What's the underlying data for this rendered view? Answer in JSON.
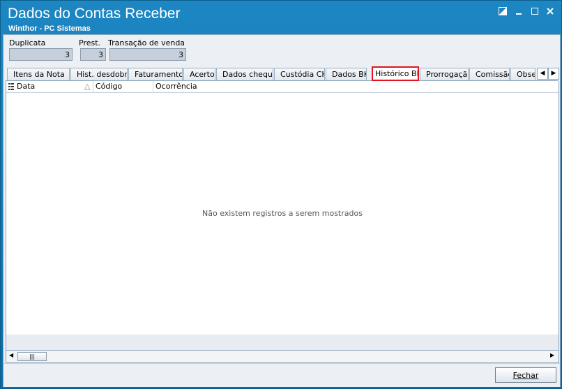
{
  "window": {
    "title": "Dados do Contas Receber",
    "subtitle": "Winthor - PC Sistemas"
  },
  "fields": {
    "duplicata": {
      "label": "Duplicata",
      "value": "3"
    },
    "prest": {
      "label": "Prest.",
      "value": "3"
    },
    "transacao": {
      "label": "Transação de venda",
      "value": "3"
    }
  },
  "tabs": [
    {
      "label": "Itens da Nota"
    },
    {
      "label": "Hist. desdobr."
    },
    {
      "label": "Faturamento"
    },
    {
      "label": "Acerto"
    },
    {
      "label": "Dados cheque"
    },
    {
      "label": "Custódia CH"
    },
    {
      "label": "Dados BK"
    },
    {
      "label": "Histórico BK",
      "active": true
    },
    {
      "label": "Prorrogação"
    },
    {
      "label": "Comissão"
    },
    {
      "label": "Obser"
    }
  ],
  "grid": {
    "columns": [
      "Data",
      "Código",
      "Ocorrência"
    ],
    "empty_message": "Não existem registros a serem mostrados"
  },
  "buttons": {
    "fechar": "Fechar"
  },
  "colors": {
    "titlebar": "#1d87c3",
    "highlight": "#e0141e"
  }
}
